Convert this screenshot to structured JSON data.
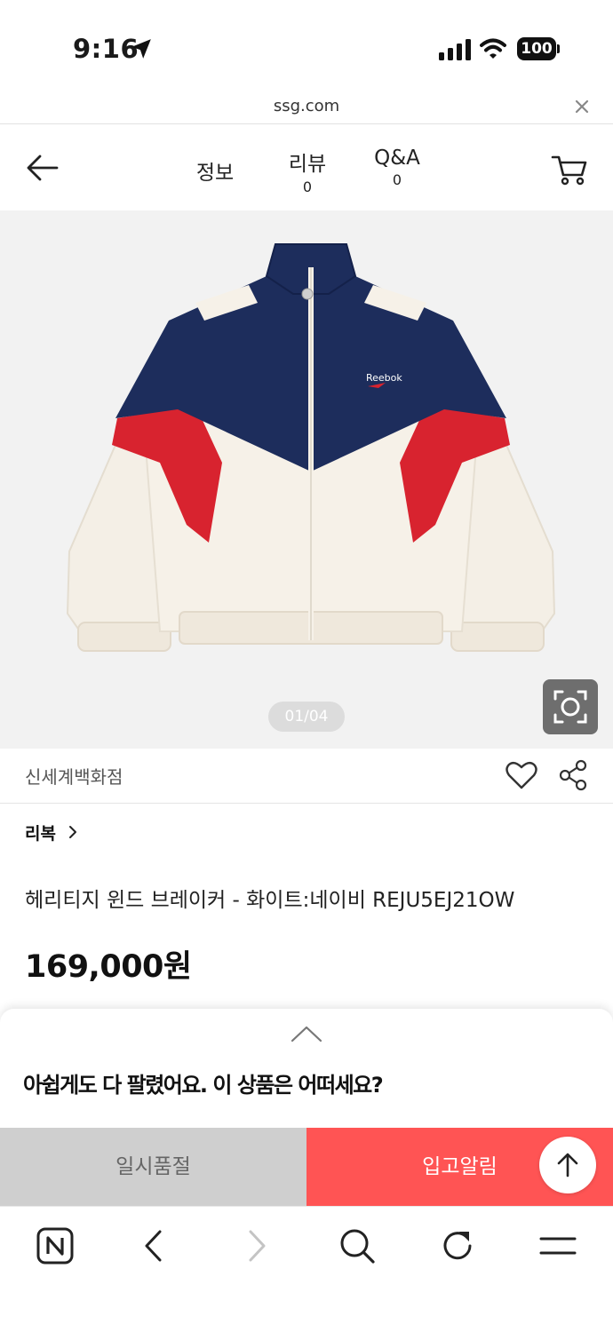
{
  "status_bar": {
    "time": "9:16",
    "battery": "100"
  },
  "url_bar": {
    "url": "ssg.com"
  },
  "nav": {
    "tabs": [
      {
        "label": "정보"
      },
      {
        "label": "리뷰",
        "count": "0"
      },
      {
        "label": "Q&A",
        "count": "0"
      }
    ]
  },
  "gallery": {
    "counter": "01/04"
  },
  "store": {
    "name": "신세계백화점"
  },
  "product": {
    "brand": "리복",
    "title": "헤리티지 윈드 브레이커 - 화이트:네이비 REJU5EJ21OW",
    "price": "169,000원",
    "image_logo_text": "Reebok"
  },
  "sheet": {
    "message": "아쉽게도 다 팔렸어요. 이 상품은 어떠세요?"
  },
  "actions": {
    "soldout_label": "일시품절",
    "notify_label": "입고알림"
  },
  "colors": {
    "accent": "#ff5454",
    "navy": "#1d2d5c",
    "red": "#d8232f",
    "cream": "#f4efe6",
    "soldout_bg": "#cfcfcf"
  },
  "icons": {
    "status": [
      "location-arrow-icon",
      "signal-icon",
      "wifi-icon",
      "battery-icon"
    ],
    "nav": [
      "back-arrow-icon",
      "cart-icon"
    ],
    "store": [
      "heart-icon",
      "share-icon"
    ],
    "toolbar": [
      "naver-home-icon",
      "chevron-left-icon",
      "chevron-right-icon",
      "search-icon",
      "refresh-icon",
      "menu-icon"
    ]
  }
}
